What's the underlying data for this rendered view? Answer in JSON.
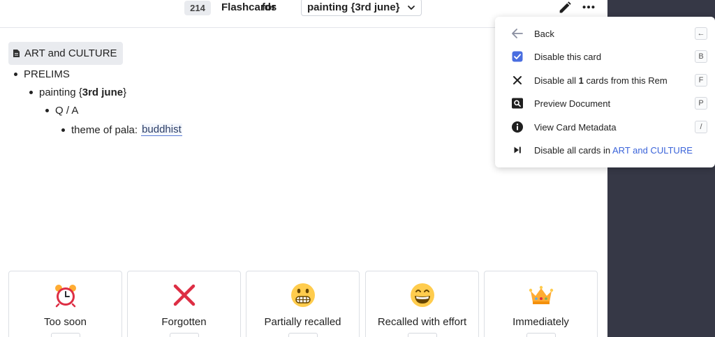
{
  "header": {
    "count": "214",
    "title": "Flashcards",
    "for": "for",
    "deck": "painting {3rd june}"
  },
  "document": {
    "title": "ART and CULTURE"
  },
  "tree": {
    "l1": "PRELIMS",
    "l2_prefix": "painting {",
    "l2_bold": "3rd june",
    "l2_suffix": "}",
    "l3": "Q / A",
    "l4_question": "theme of pala:",
    "l4_answer": "buddhist"
  },
  "menu": {
    "items": [
      {
        "label": "Back",
        "key": "←",
        "icon": "arrow-left-icon"
      },
      {
        "label": "Disable this card",
        "key": "B",
        "icon": "checkbox-checked-icon"
      },
      {
        "label_pre": "Disable all ",
        "label_bold": "1",
        "label_post": " cards from this Rem",
        "key": "F",
        "icon": "close-icon"
      },
      {
        "label": "Preview Document",
        "key": "P",
        "icon": "search-icon"
      },
      {
        "label": "View Card Metadata",
        "key": "/",
        "icon": "info-icon"
      },
      {
        "label_pre": "Disable all cards in ",
        "label_link": "ART and CULTURE",
        "icon": "skip-next-icon"
      }
    ]
  },
  "responses": [
    {
      "label": "Too soon",
      "icon": "alarm-clock-icon"
    },
    {
      "label": "Forgotten",
      "icon": "cross-mark-icon"
    },
    {
      "label": "Partially recalled",
      "icon": "grimacing-face-icon"
    },
    {
      "label": "Recalled with effort",
      "icon": "grinning-face-icon"
    },
    {
      "label": "Immediately",
      "icon": "crown-icon"
    }
  ],
  "colors": {
    "accent": "#3a63d9",
    "sidebar": "#363846",
    "checkbox": "#4a6ee0",
    "forgotten": "#dd2e44"
  }
}
